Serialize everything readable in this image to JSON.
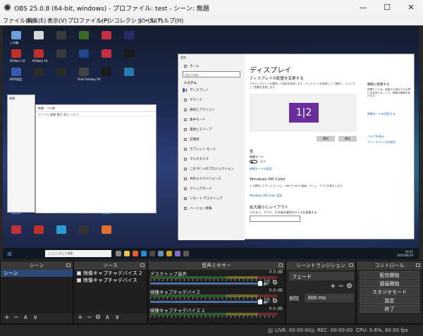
{
  "window": {
    "title": "OBS 25.0.8 (64-bit, windows) - プロファイル: test - シーン: 無題",
    "minimize": "—",
    "maximize": "☐",
    "close": "✕"
  },
  "menu": [
    "ファイル(F)",
    "編集(E)",
    "表示(V)",
    "プロファイル(P)",
    "シーンコレクション(S)",
    "ツール(T)",
    "ヘルプ(H)"
  ],
  "desktop_icons": [
    {
      "label": "ごみ箱",
      "color": "#6aa0d8"
    },
    {
      "label": "",
      "color": "#d8d8d8"
    },
    {
      "label": "",
      "color": "#3a3a3a"
    },
    {
      "label": "",
      "color": "#3a6a2a"
    },
    {
      "label": "",
      "color": "#c03040"
    },
    {
      "label": "",
      "color": "#2a2a6a"
    },
    {
      "label": "PCMark 10",
      "color": "#c0302a"
    },
    {
      "label": "PCMark 10",
      "color": "#c0302a"
    },
    {
      "label": "",
      "color": "#3a3a3a"
    },
    {
      "label": "",
      "color": "#224488"
    },
    {
      "label": "",
      "color": "#c03040"
    },
    {
      "label": "",
      "color": "#1a1a1a"
    },
    {
      "label": "BIOS設定",
      "color": "#3a5ab0"
    },
    {
      "label": "",
      "color": "#2a2a2a"
    },
    {
      "label": "",
      "color": "#2a2a2a"
    },
    {
      "label": "Final Fantasy XV",
      "color": "#444"
    },
    {
      "label": "",
      "color": "#1a1a1a"
    },
    {
      "label": "",
      "color": "#2a7ab0"
    }
  ],
  "notepad": {
    "title": "無題 - メモ帳",
    "menu": "ファイル 編集 書式 表示 ヘルプ"
  },
  "small_window": {
    "title": "無題"
  },
  "taskbar": {
    "search_placeholder": "ここに入力して検索",
    "time": "19:55",
    "date": "2020/06/19"
  },
  "settings": {
    "title_bar": "設定",
    "home": "ホーム",
    "search_placeholder": "設定の検索",
    "section": "システム",
    "nav": [
      "ディスプレイ",
      "サウンド",
      "通知とアクション",
      "集中モード",
      "電源とスリープ",
      "記憶域",
      "タブレット モード",
      "マルチタスク",
      "この PC へのプロジェクション",
      "共有エクスペリエンス",
      "クリップボード",
      "リモート デスクトップ",
      "バージョン情報"
    ],
    "page_title": "ディスプレイ",
    "arrange_title": "ディスプレイの配置を変更する",
    "arrange_desc": "下のディスプレイを選択して設定を変更します。ディスプレイを長押しして選択し、ドラッグして配置を変更します。",
    "monitor_label": "1|2",
    "identify_button": "識別",
    "detect_button": "検出",
    "color_title": "色",
    "night_light": "夜間モード",
    "night_light_state": "オフ",
    "night_light_link": "夜間モードの設定",
    "hdr_title": "Windows HD Color",
    "hdr_desc": "上で選択したディスプレイに、HDR や WCG 動画、ゲーム、アプリを表示します。",
    "hdr_link": "Windows HD Color 設定",
    "scale_title": "拡大縮小とレイアウト",
    "scale_desc": "テキスト、アプリ、その他の項目のサイズを変更する",
    "side_title": "睡眠に配慮する",
    "side_desc": "夜間モードは、画面から放出される青い光を抑えることで、夜間の睡眠を助けます。",
    "side_link": "夜間モードを設定する",
    "help_link": "ヘルプを表示",
    "feedback_link": "フィードバックの送信"
  },
  "docks": {
    "scenes": {
      "title": "シーン",
      "items": [
        "シーン"
      ]
    },
    "sources": {
      "title": "ソース",
      "items": [
        "映像キャプチャデバイス 2",
        "映像キャプチャデバイス"
      ]
    },
    "mixer": {
      "title": "音声ミキサー",
      "channels": [
        {
          "name": "デスクトップ音声",
          "db": "0.0 dB"
        },
        {
          "name": "映像キャプチャデバイス",
          "db": "0.0 dB"
        },
        {
          "name": "映像キャプチャデバイス 2",
          "db": "0.0 dB"
        }
      ]
    },
    "transitions": {
      "title": "シーントランジション",
      "selected": "フェード",
      "duration_label": "期間",
      "duration": "300 ms"
    },
    "controls": {
      "title": "コントロール",
      "buttons": [
        "配信開始",
        "録画開始",
        "スタジオモード",
        "設定",
        "終了"
      ]
    }
  },
  "footer": {
    "add": "+",
    "remove": "−",
    "up": "∧",
    "down": "∨",
    "gear": "⚙",
    "speaker": "🔊"
  },
  "status": {
    "live": "LIVE: 00:00:00",
    "rec": "REC: 00:00:00",
    "cpu": "CPU: 0.6%, 60.00 fps"
  }
}
